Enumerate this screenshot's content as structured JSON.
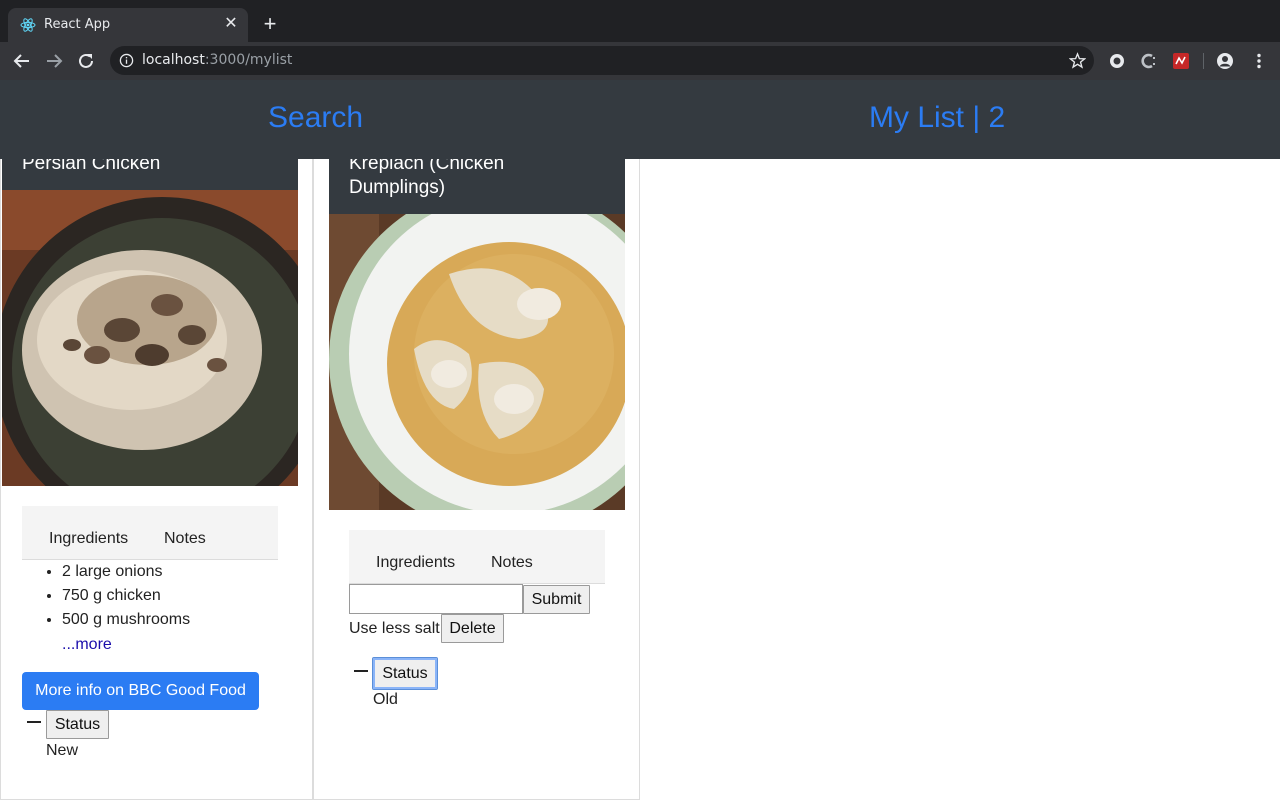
{
  "browser": {
    "tab_title": "React App",
    "tab_favicon": "react-logo-icon",
    "url_host": "localhost",
    "url_rest": ":3000/mylist",
    "icons": [
      "back-arrow-icon",
      "forward-arrow-icon",
      "reload-icon",
      "info-icon",
      "star-icon",
      "extension-icon",
      "extension-c-icon",
      "extension-red-icon",
      "profile-icon",
      "menu-dots-icon"
    ]
  },
  "navbar": {
    "search_label": "Search",
    "mylist_label": "My List | 2",
    "link_color": "#2b7cf3",
    "bg_color": "#343a40"
  },
  "cards": [
    {
      "title": "Persian Chicken",
      "tabs": [
        "Ingredients",
        "Notes"
      ],
      "ingredients": [
        "2 large onions",
        "750 g chicken",
        "500 g mushrooms"
      ],
      "more_label": "...more",
      "info_button": "More info on BBC Good Food",
      "status_button": "Status",
      "status_value": "New"
    },
    {
      "title": "Kreplach (Chicken Dumplings)",
      "tabs": [
        "Ingredients",
        "Notes"
      ],
      "note_input_value": "",
      "submit_label": "Submit",
      "note": "Use less salt",
      "delete_label": "Delete",
      "status_button": "Status",
      "status_value": "Old"
    }
  ]
}
